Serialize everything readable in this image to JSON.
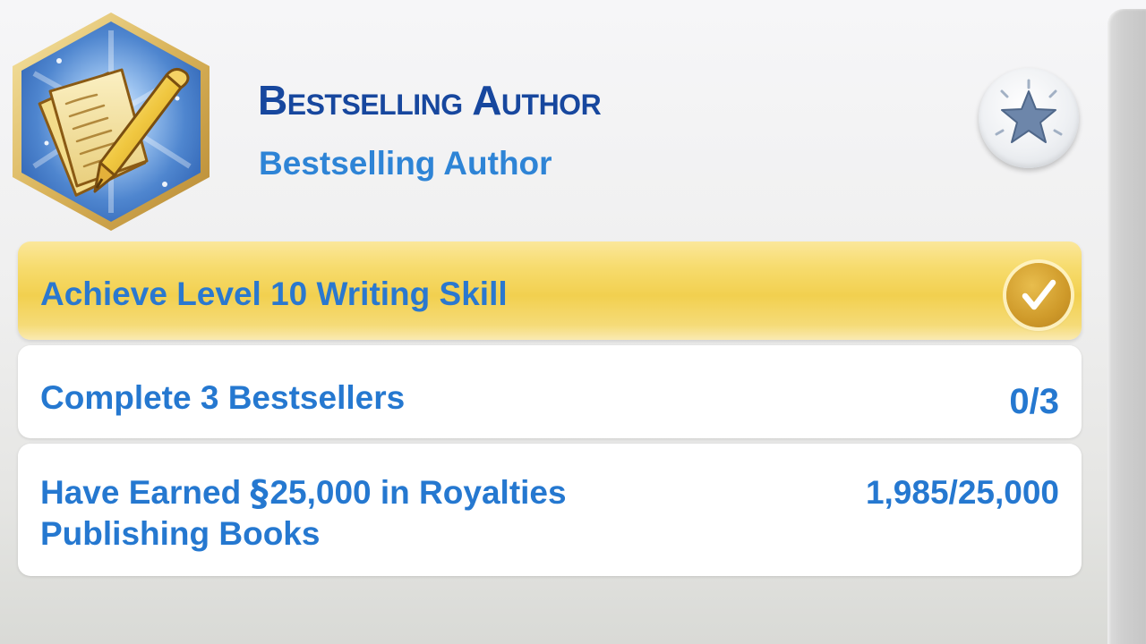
{
  "aspiration": {
    "title": "Bestselling Author",
    "subtitle": "Bestselling Author",
    "badge_icon": "writing-paper-and-pen-icon",
    "favorite_icon": "star-icon"
  },
  "objectives": [
    {
      "label": "Achieve Level 10 Writing Skill",
      "completed": true,
      "status_icon": "checkmark-icon"
    },
    {
      "label": "Complete 3 Bestsellers",
      "progress_text": "0/3",
      "completed": false
    },
    {
      "label_prefix": "Have Earned",
      "currency_symbol": "§",
      "label_suffix": "25,000 in Royalties Publishing Books",
      "progress_text": "1,985/25,000",
      "completed": false
    }
  ],
  "colors": {
    "title": "#17479e",
    "subtitle": "#2e84d6",
    "objective_text": "#2578d0",
    "completed_row": "#f2d04f",
    "checkmark_badge": "#cf9a2a"
  }
}
